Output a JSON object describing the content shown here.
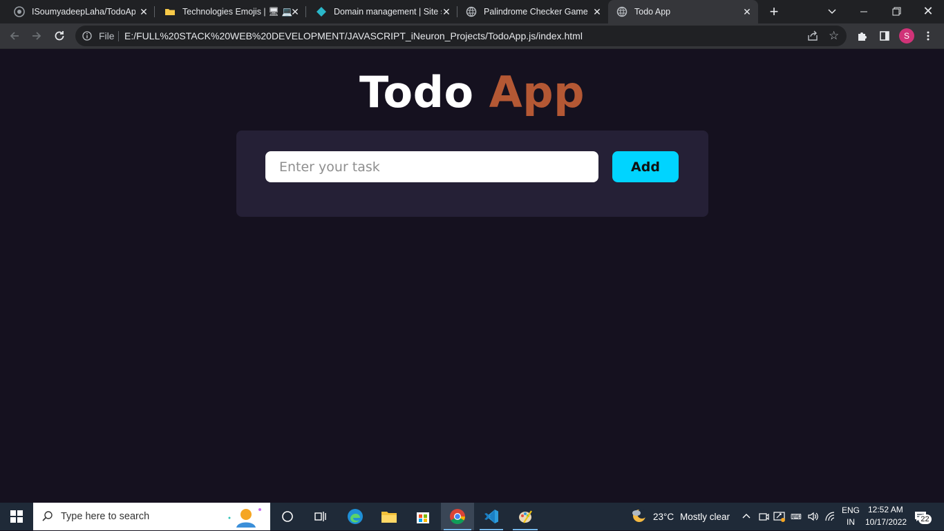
{
  "browser": {
    "tabs": [
      {
        "title": "ISoumyadeepLaha/TodoApp",
        "icon": "github-icon",
        "active": false
      },
      {
        "title": "Technologies Emojis | 🖥 💻 📱",
        "icon": "folder-icon",
        "active": false
      },
      {
        "title": "Domain management | Site s",
        "icon": "diamond-icon",
        "active": false
      },
      {
        "title": "Palindrome Checker Game",
        "icon": "globe-icon",
        "active": false
      },
      {
        "title": "Todo App",
        "icon": "globe-icon",
        "active": true
      }
    ],
    "omnibox": {
      "scheme_label": "File",
      "url": "E:/FULL%20STACK%20WEB%20DEVELOPMENT/JAVASCRIPT_iNeuron_Projects/TodoApp.js/index.html"
    },
    "profile_initial": "S",
    "profile_color": "#d03378"
  },
  "app": {
    "title_word1": "Todo",
    "title_word2": "App",
    "accent_color": "#b45834",
    "input_placeholder": "Enter your task",
    "input_value": "",
    "add_label": "Add",
    "button_color": "#00d4ff"
  },
  "taskbar": {
    "search_placeholder": "Type here to search",
    "weather": {
      "temp": "23°C",
      "condition": "Mostly clear"
    },
    "language": {
      "line1": "ENG",
      "line2": "IN"
    },
    "clock": {
      "time": "12:52 AM",
      "date": "10/17/2022"
    },
    "notification_count": "22"
  }
}
